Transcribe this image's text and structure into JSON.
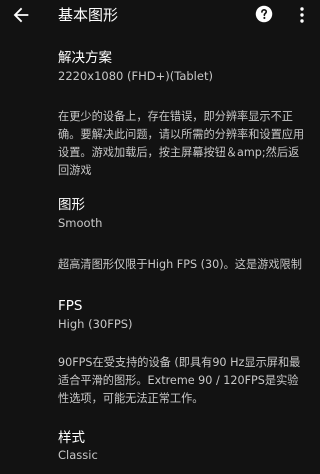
{
  "appbar": {
    "title": "基本图形",
    "back_icon": "arrow-back-icon",
    "help_icon": "help-circle-icon",
    "more_icon": "more-vert-icon"
  },
  "settings": {
    "resolution": {
      "title": "解决方案",
      "value": "2220x1080 (FHD+)(Tablet)"
    },
    "resolution_note": "在更少的设备上，存在错误，即分辨率显示不正确。要解决此问题，请以所需的分辨率和设置应用设置。游戏加载后，按主屏幕按钮＆amp;然后返回游戏",
    "graphics": {
      "title": "图形",
      "value": "Smooth"
    },
    "graphics_note": "超高清图形仅限于High FPS (30)。这是游戏限制",
    "fps": {
      "title": "FPS",
      "value": "High (30FPS)"
    },
    "fps_note": "90FPS在受支持的设备 (即具有90 Hz显示屏和最适合平滑的图形。Extreme 90 / 120FPS是实验性选项，可能无法正常工作。",
    "style": {
      "title": "样式",
      "value": "Classic"
    }
  }
}
